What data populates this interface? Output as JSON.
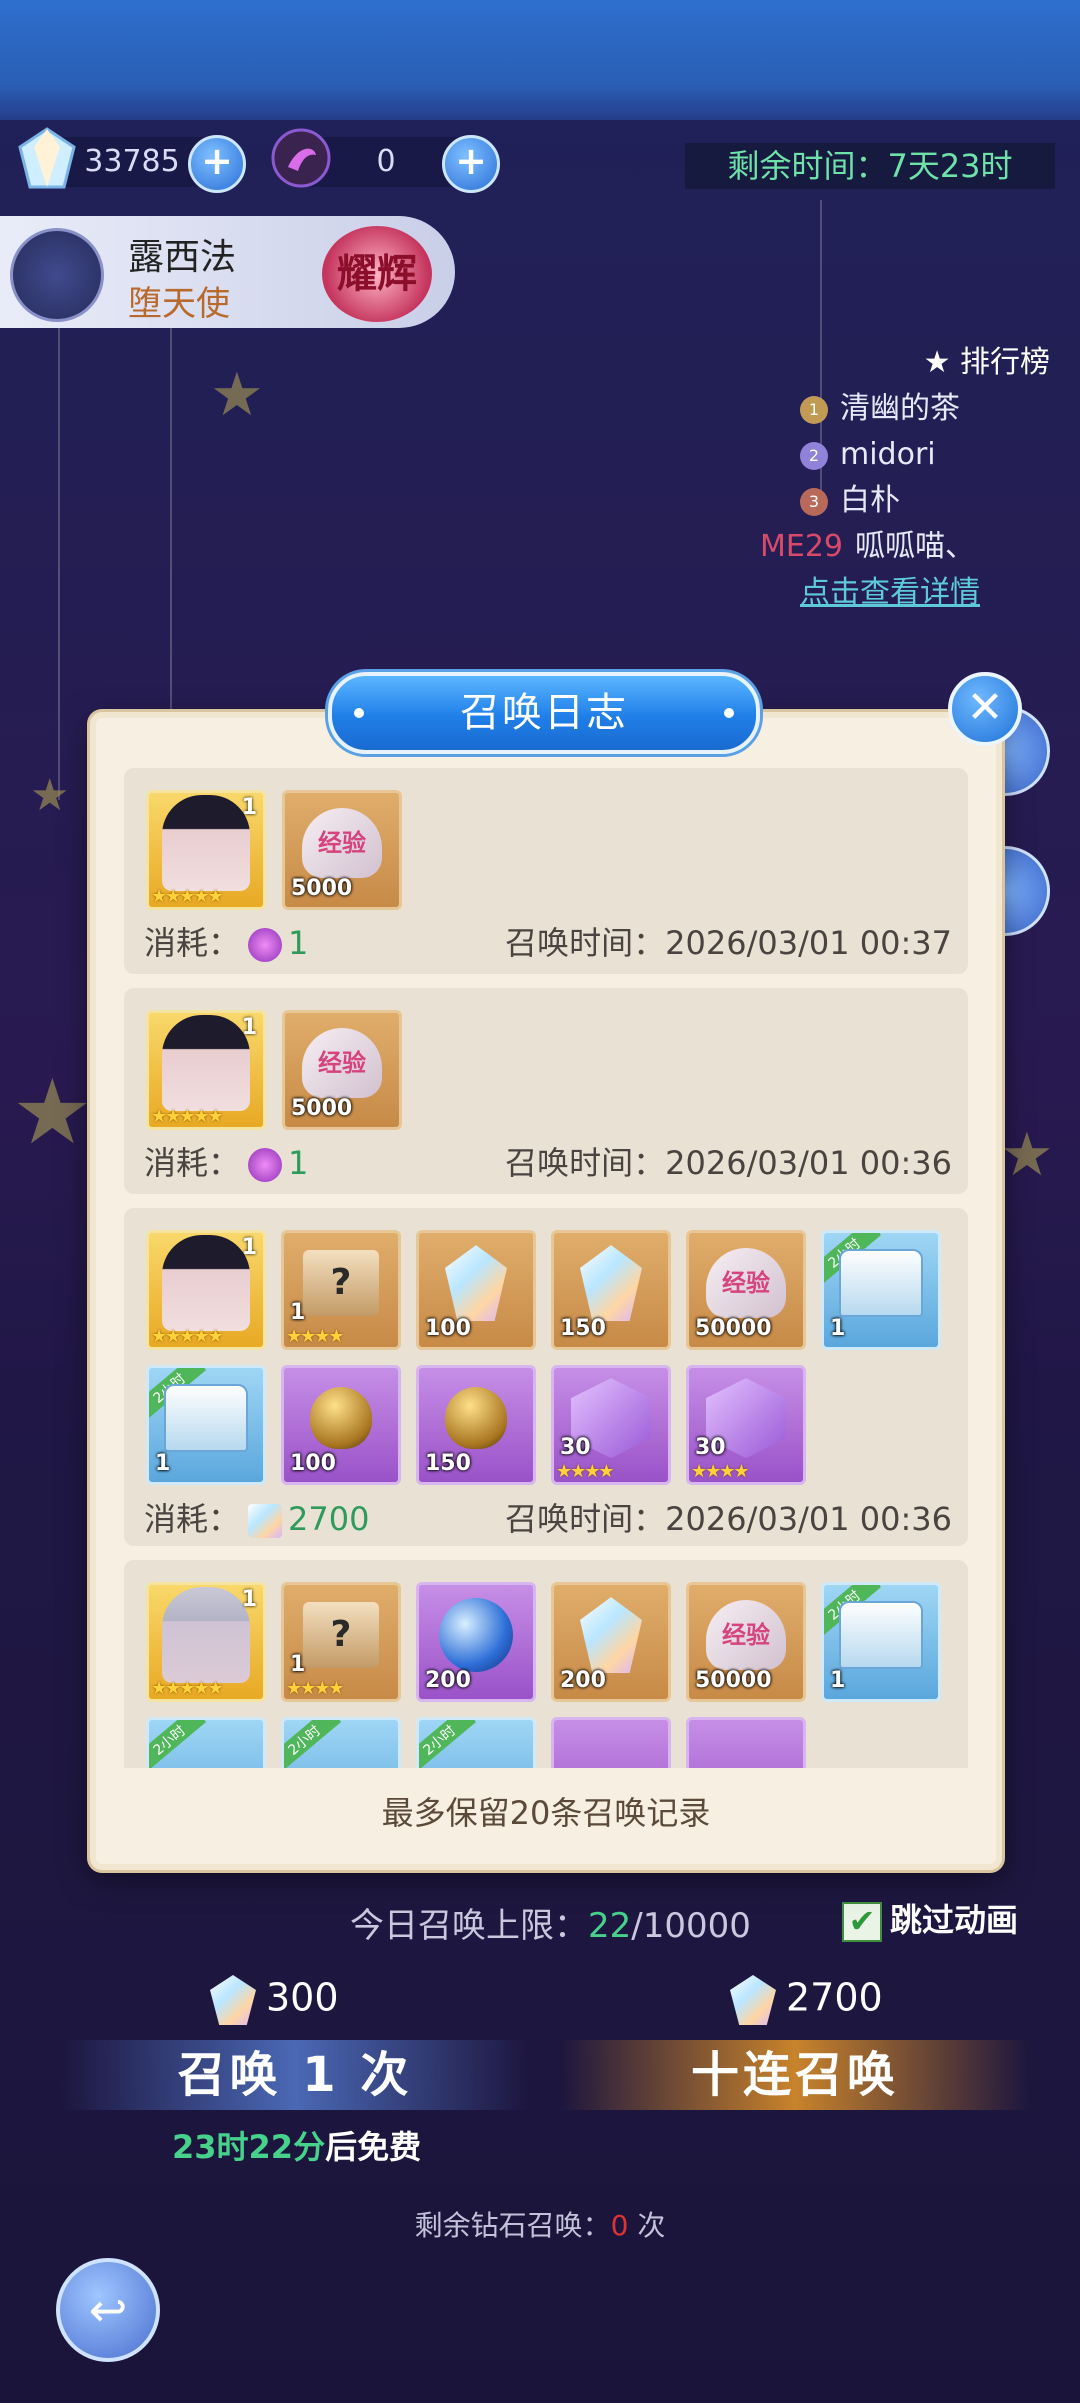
{
  "resources": {
    "diamonds": "33785",
    "summon_tickets": "0",
    "timer": "剩余时间：7天23时"
  },
  "character": {
    "name": "露西法",
    "title": "堕天使",
    "badge": "耀辉"
  },
  "ranking": {
    "title": "排行榜",
    "entries": [
      "清幽的茶",
      "midori",
      "白朴",
      "呱呱喵、"
    ],
    "me_label": "ME29",
    "detail_link": "点击查看详情"
  },
  "modal": {
    "title": "召唤日志",
    "footer": "最多保留20条召唤记录",
    "cost_label": "消耗：",
    "time_label": "召唤时间：",
    "records": [
      {
        "cost": "1",
        "time": "2026/03/01 00:37",
        "items": [
          {
            "qty": "1",
            "stars": "★★★★★"
          },
          {
            "qty": "5000"
          }
        ]
      },
      {
        "cost": "1",
        "time": "2026/03/01 00:36",
        "items": [
          {
            "qty": "1",
            "stars": "★★★★★"
          },
          {
            "qty": "5000"
          }
        ]
      },
      {
        "cost": "2700",
        "time": "2026/03/01 00:36",
        "items": [
          {
            "qty": "1",
            "stars": "★★★★★"
          },
          {
            "qty": "1",
            "stars": "★★★★"
          },
          {
            "qty": "100"
          },
          {
            "qty": "150"
          },
          {
            "qty": "50000"
          },
          {
            "qty": "1",
            "tag": "2小时"
          },
          {
            "qty": "1",
            "tag": "2小时"
          },
          {
            "qty": "100"
          },
          {
            "qty": "150"
          },
          {
            "qty": "30",
            "stars": "★★★★"
          },
          {
            "qty": "30",
            "stars": "★★★★"
          }
        ]
      },
      {
        "items": [
          {
            "qty": "1",
            "stars": "★★★★★"
          },
          {
            "qty": "1",
            "stars": "★★★★"
          },
          {
            "qty": "200"
          },
          {
            "qty": "200"
          },
          {
            "qty": "50000"
          },
          {
            "qty": "1",
            "tag": "2小时"
          },
          {
            "tag": "2小时"
          },
          {
            "tag": "2小时"
          },
          {
            "tag": "2小时"
          }
        ]
      }
    ],
    "heart_label": "经验"
  },
  "bottom": {
    "limit_label": "今日召唤上限：",
    "limit_current": "22",
    "limit_max": "/10000",
    "skip_label": "跳过动画",
    "price_single": "300",
    "price_ten": "2700",
    "summon_one": "召唤 1 次",
    "summon_ten": "十连召唤",
    "free_time": "23时22分",
    "free_suffix": "后免费",
    "remain_prefix": "剩余钻石召唤：",
    "remain_count": "0",
    "remain_suffix": "次"
  }
}
